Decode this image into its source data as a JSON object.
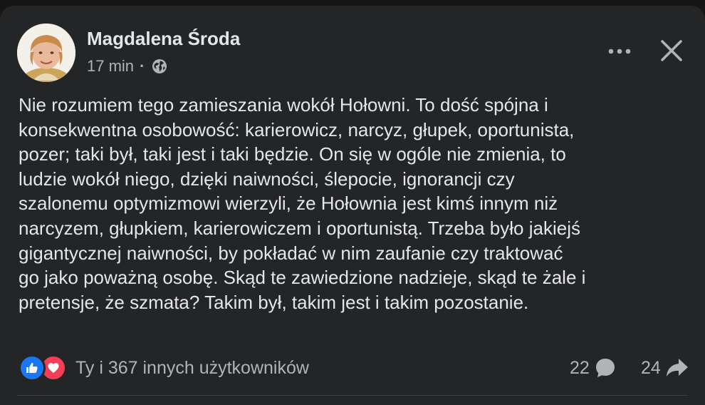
{
  "post": {
    "author": "Magdalena Środa",
    "time": "17 min",
    "separator": "·",
    "audience_icon": "globe-icon",
    "text": "Nie rozumiem tego zamieszania wokół Hołowni. To dość spójna i\nkonsekwentna osobowość: karierowicz, narcyz, głupek, oportunista,\npozer; taki był, taki jest i taki będzie. On się w ogóle nie zmienia, to\nludzie wokół niego, dzięki naiwności, ślepocie, ignorancji czy\nszalonemu optymizmowi wierzyli, że Hołownia jest kimś innym niż\nnarcyzem, głupkiem, karierowiczem i oportunistą. Trzeba było jakiejś\ngigantycznej naiwności, by pokładać w nim zaufanie czy traktować\ngo jako poważną osobę. Skąd te zawiedzione nadzieje, skąd te żale i\npretensje, że szmata? Takim był, takim jest i takim pozostanie."
  },
  "header_actions": {
    "more_icon": "more-horizontal-icon",
    "close_icon": "close-icon"
  },
  "footer": {
    "reactions_text": "Ty i 367 innych użytkowników",
    "reaction_icons": [
      "like-icon",
      "love-icon"
    ],
    "comments_count": "22",
    "shares_count": "24"
  },
  "colors": {
    "background": "#161616",
    "card": "#242526",
    "primary_text": "#e4e6eb",
    "secondary_text": "#b0b3b8",
    "like_blue": "#1877f2",
    "love_red": "#f33e58"
  }
}
